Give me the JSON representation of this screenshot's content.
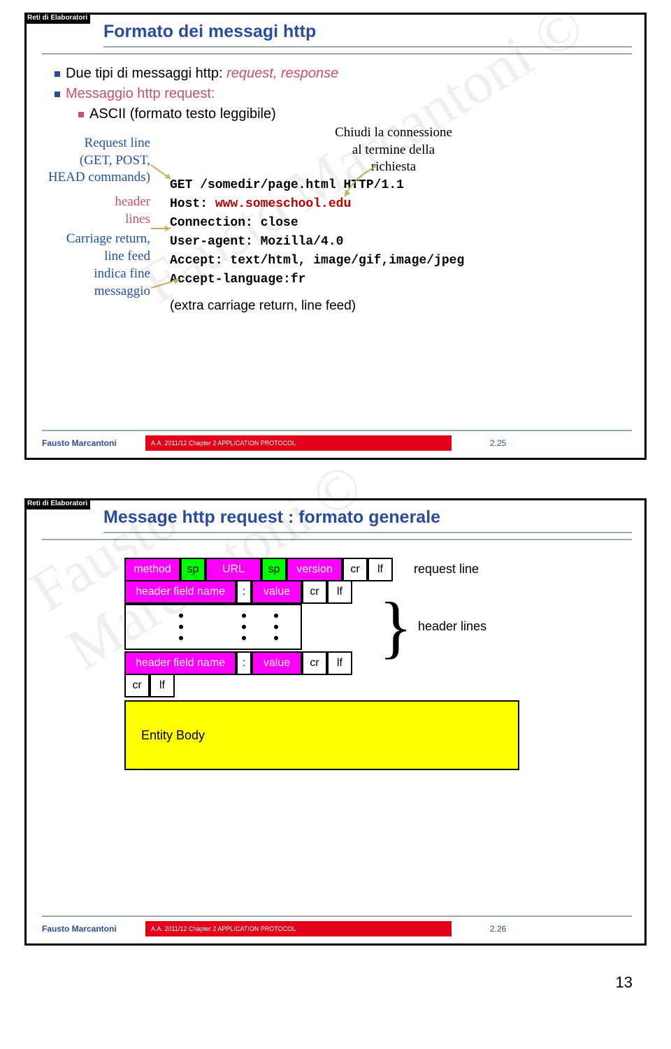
{
  "badge": "Reti di Elaboratori",
  "footer_name": "Fausto Marcantoni",
  "footer_bar": "A.A. 2011/12  Chapter 2  APPLICATION PROTOCOL",
  "watermark": "Fausto Marcantoni ©",
  "slide1": {
    "title": "Formato dei messagi http",
    "b1_pre": "Due tipi di messaggi http: ",
    "b1_it": "request, response",
    "b2": "Messaggio http request:",
    "b3": "ASCII (formato testo leggibile)",
    "left_req_a": "Request line",
    "left_req_b": "(GET, POST,",
    "left_req_c": "HEAD commands)",
    "left_hd_a": "header",
    "left_hd_b": "lines",
    "left_cr_a": "Carriage return,",
    "left_cr_b": "line feed",
    "left_cr_c": "indica fine",
    "left_cr_d": "messaggio",
    "callout_a": "Chiudi la connessione",
    "callout_b": "al termine della",
    "callout_c": "richiesta",
    "m1": "GET /somedir/page.html HTTP/1.1",
    "m2_a": "Host: ",
    "m2_b": "www.someschool.edu",
    "m3": "Connection: close",
    "m4": "User-agent: Mozilla/4.0",
    "m5": "Accept: text/html, image/gif,image/jpeg",
    "m6": "Accept-language:fr",
    "m7": "(extra carriage return, line feed)",
    "page": "2.25"
  },
  "slide2": {
    "title": "Message http request : formato generale",
    "method": "method",
    "sp": "sp",
    "url": "URL",
    "version": "version",
    "cr": "cr",
    "lf": "lf",
    "req_line": "request line",
    "hdr_name": "header field name",
    "colon": ":",
    "value": "value",
    "hdr_lines": "header lines",
    "entity": "Entity Body",
    "page": "2.26"
  },
  "pagenum": "13"
}
